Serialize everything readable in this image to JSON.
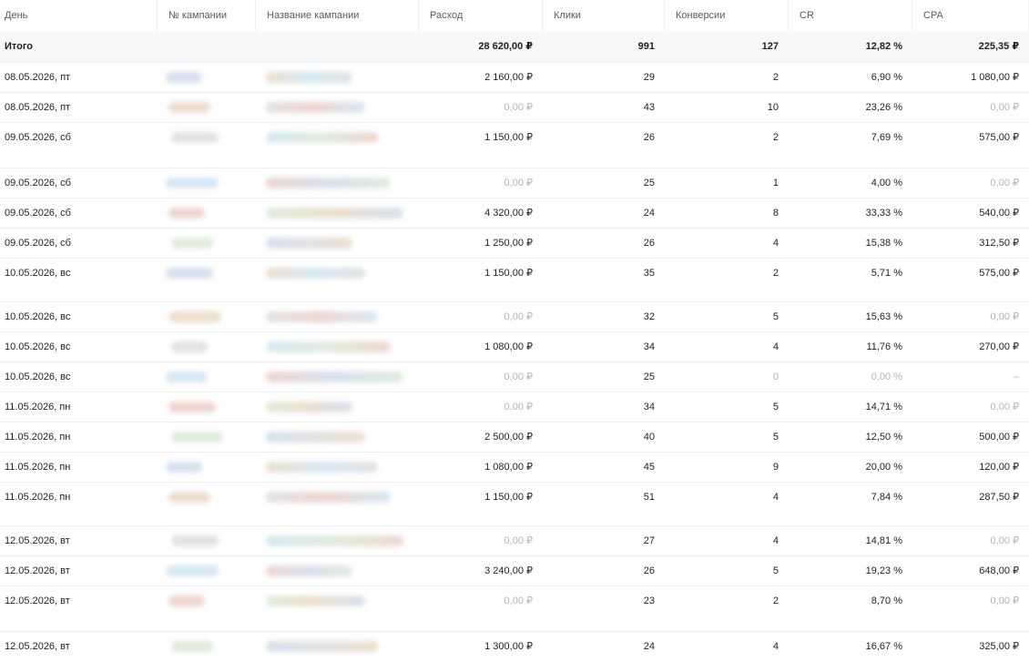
{
  "columns": {
    "day": "День",
    "campaign_num": "№ кампании",
    "campaign_name": "Название кампании",
    "spend": "Расход",
    "clicks": "Клики",
    "conversions": "Конверсии",
    "cr": "CR",
    "cpa": "CPA"
  },
  "total": {
    "label": "Итого",
    "spend": "28 620,00 ₽",
    "clicks": "991",
    "conversions": "127",
    "cr": "12,82 %",
    "cpa": "225,35 ₽"
  },
  "rows": [
    {
      "day": "08.05.2026, пт",
      "spend": "2 160,00 ₽",
      "clicks": "29",
      "conversions": "2",
      "cr": "6,90 %",
      "cpa": "1 080,00 ₽"
    },
    {
      "day": "08.05.2026, пт",
      "spend": "0,00 ₽",
      "clicks": "43",
      "conversions": "10",
      "cr": "23,26 %",
      "cpa": "0,00 ₽"
    },
    {
      "day": "09.05.2026, сб",
      "spend": "1 150,00 ₽",
      "clicks": "26",
      "conversions": "2",
      "cr": "7,69 %",
      "cpa": "575,00 ₽"
    },
    {
      "day": "09.05.2026, сб",
      "spend": "0,00 ₽",
      "clicks": "25",
      "conversions": "1",
      "cr": "4,00 %",
      "cpa": "0,00 ₽"
    },
    {
      "day": "09.05.2026, сб",
      "spend": "4 320,00 ₽",
      "clicks": "24",
      "conversions": "8",
      "cr": "33,33 %",
      "cpa": "540,00 ₽"
    },
    {
      "day": "09.05.2026, сб",
      "spend": "1 250,00 ₽",
      "clicks": "26",
      "conversions": "4",
      "cr": "15,38 %",
      "cpa": "312,50 ₽"
    },
    {
      "day": "10.05.2026, вс",
      "spend": "1 150,00 ₽",
      "clicks": "35",
      "conversions": "2",
      "cr": "5,71 %",
      "cpa": "575,00 ₽"
    },
    {
      "day": "10.05.2026, вс",
      "spend": "0,00 ₽",
      "clicks": "32",
      "conversions": "5",
      "cr": "15,63 %",
      "cpa": "0,00 ₽"
    },
    {
      "day": "10.05.2026, вс",
      "spend": "1 080,00 ₽",
      "clicks": "34",
      "conversions": "4",
      "cr": "11,76 %",
      "cpa": "270,00 ₽"
    },
    {
      "day": "10.05.2026, вс",
      "spend": "0,00 ₽",
      "clicks": "25",
      "conversions": "0",
      "cr": "0,00 %",
      "cpa": "–"
    },
    {
      "day": "11.05.2026, пн",
      "spend": "0,00 ₽",
      "clicks": "34",
      "conversions": "5",
      "cr": "14,71 %",
      "cpa": "0,00 ₽"
    },
    {
      "day": "11.05.2026, пн",
      "spend": "2 500,00 ₽",
      "clicks": "40",
      "conversions": "5",
      "cr": "12,50 %",
      "cpa": "500,00 ₽"
    },
    {
      "day": "11.05.2026, пн",
      "spend": "1 080,00 ₽",
      "clicks": "45",
      "conversions": "9",
      "cr": "20,00 %",
      "cpa": "120,00 ₽"
    },
    {
      "day": "11.05.2026, пн",
      "spend": "1 150,00 ₽",
      "clicks": "51",
      "conversions": "4",
      "cr": "7,84 %",
      "cpa": "287,50 ₽"
    },
    {
      "day": "12.05.2026, вт",
      "spend": "0,00 ₽",
      "clicks": "27",
      "conversions": "4",
      "cr": "14,81 %",
      "cpa": "0,00 ₽"
    },
    {
      "day": "12.05.2026, вт",
      "spend": "3 240,00 ₽",
      "clicks": "26",
      "conversions": "5",
      "cr": "19,23 %",
      "cpa": "648,00 ₽"
    },
    {
      "day": "12.05.2026, вт",
      "spend": "0,00 ₽",
      "clicks": "23",
      "conversions": "2",
      "cr": "8,70 %",
      "cpa": "0,00 ₽"
    },
    {
      "day": "12.05.2026, вт",
      "spend": "1 300,00 ₽",
      "clicks": "24",
      "conversions": "4",
      "cr": "16,67 %",
      "cpa": "325,00 ₽"
    }
  ],
  "colors": {
    "muted_text": "#b4b4b4",
    "total_row_bg": "#f6f7f9",
    "header_text": "#5a5a5a"
  }
}
